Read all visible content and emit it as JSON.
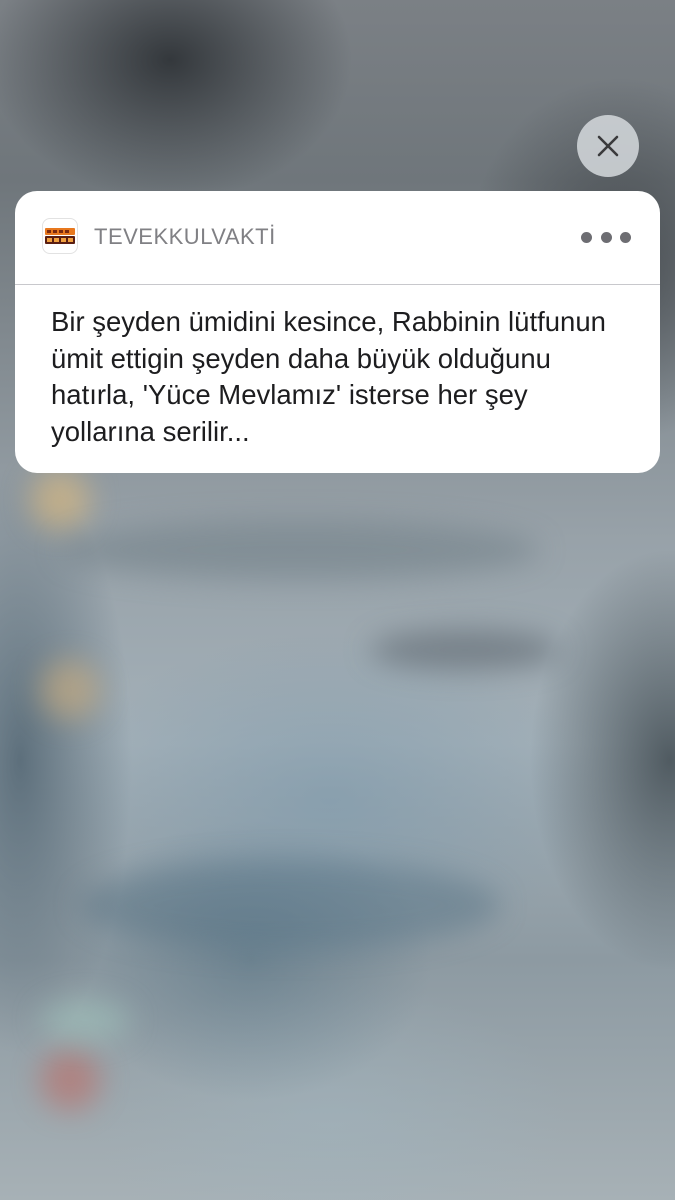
{
  "notification": {
    "app_name": "TEVEKKULVAKTİ",
    "app_icon": "tevekkul-vakti-logo-icon",
    "message": "Bir şeyden ümidini kesince, Rabbinin lütfunun ümit ettigin şeyden daha büyük olduğunu hatırla, 'Yüce Mevlamız' isterse her şey yollarına serilir...",
    "more_icon": "more-options-icon"
  },
  "close_button": {
    "icon": "close-icon"
  },
  "colors": {
    "card_background": "#ffffff",
    "app_name": "#808084",
    "message_text": "#1d1d1f",
    "icon_orange": "#e8781e",
    "icon_dark": "#5a1e12"
  }
}
